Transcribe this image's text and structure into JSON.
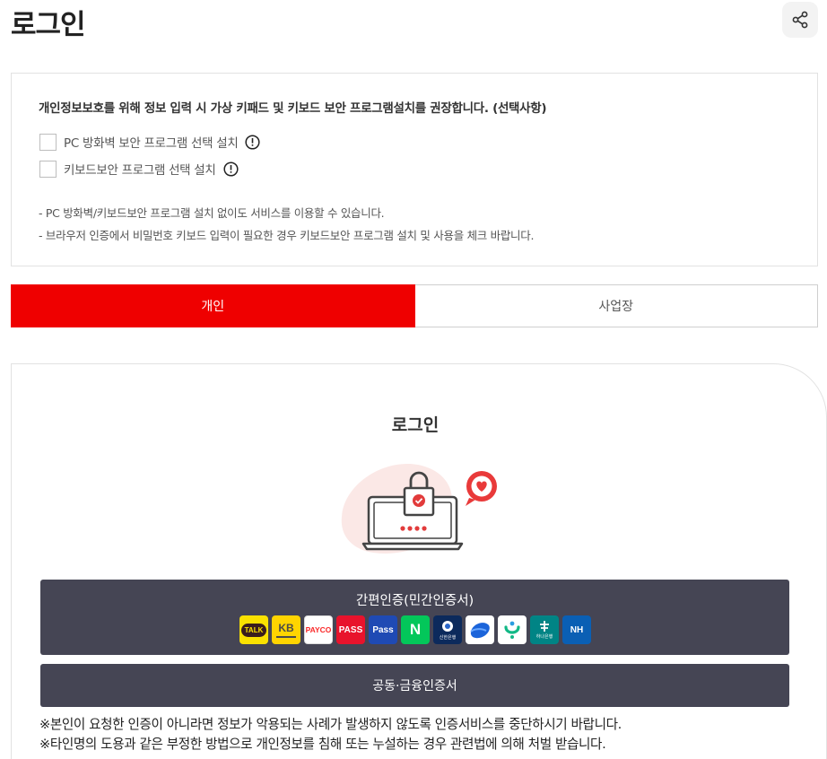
{
  "page": {
    "title": "로그인"
  },
  "notice": {
    "title": "개인정보보호를 위해 정보 입력 시 가상 키패드 및 키보드 보안 프로그램설치를 권장합니다. (선택사항)",
    "options": [
      {
        "label": "PC 방화벽 보안 프로그램 선택 설치",
        "checked": false
      },
      {
        "label": "키보드보안 프로그램 선택 설치",
        "checked": false
      }
    ],
    "bullets": [
      "- PC 방화벽/키보드보안 프로그램 설치 없이도 서비스를 이용할 수 있습니다.",
      "- 브라우저 인증에서 비밀번호 키보드 입력이 필요한 경우 키보드보안 프로그램 설치 및 사용을 체크 바랍니다."
    ]
  },
  "tabs": [
    {
      "label": "개인",
      "active": true
    },
    {
      "label": "사업장",
      "active": false
    }
  ],
  "login": {
    "title": "로그인",
    "simple_auth_label": "간편인증(민간인증서)",
    "providers": [
      {
        "name": "kakao",
        "text": "TALK",
        "bg": "#fae100",
        "fg": "#3a1d1d"
      },
      {
        "name": "kb",
        "text": "KB",
        "bg": "#ffd400",
        "fg": "#4a4a4a"
      },
      {
        "name": "payco",
        "text": "PAYCO",
        "bg": "#ffffff",
        "fg": "#fa2828"
      },
      {
        "name": "pass",
        "text": "PASS",
        "bg": "#e8132c",
        "fg": "#ffffff"
      },
      {
        "name": "samsung-pass",
        "text": "Pass",
        "bg": "#1f4ab4",
        "fg": "#ffffff"
      },
      {
        "name": "naver",
        "text": "N",
        "bg": "#03c75a",
        "fg": "#ffffff"
      },
      {
        "name": "shinhan",
        "text": "신한은행",
        "bg": "#0c2a5c",
        "fg": "#ffffff"
      },
      {
        "name": "toss",
        "text": "",
        "bg": "#ffffff",
        "fg": "#1b64da"
      },
      {
        "name": "banksalad",
        "text": "",
        "bg": "#ffffff",
        "fg": "#12b886"
      },
      {
        "name": "hana",
        "text": "하나은행",
        "bg": "#008485",
        "fg": "#ffffff"
      },
      {
        "name": "nh",
        "text": "NH",
        "bg": "#0a5fb4",
        "fg": "#ffffff"
      }
    ],
    "cert_label": "공동·금융인증서"
  },
  "warnings": [
    "※본인이 요청한 인증이 아니라면 정보가 악용되는 사례가 발생하지 않도록 인증서비스를 중단하시기 바랍니다.",
    "※타인명의 도용과 같은 부정한 방법으로 개인정보를 침해 또는 누설하는 경우 관련법에 의해 처벌 받습니다."
  ],
  "colors": {
    "accent": "#ef0000",
    "button_dark": "#454554",
    "border": "#e2e2e2"
  },
  "icons": {
    "share": "share-icon",
    "info": "info-icon",
    "illustration": "laptop-lock-icon"
  }
}
